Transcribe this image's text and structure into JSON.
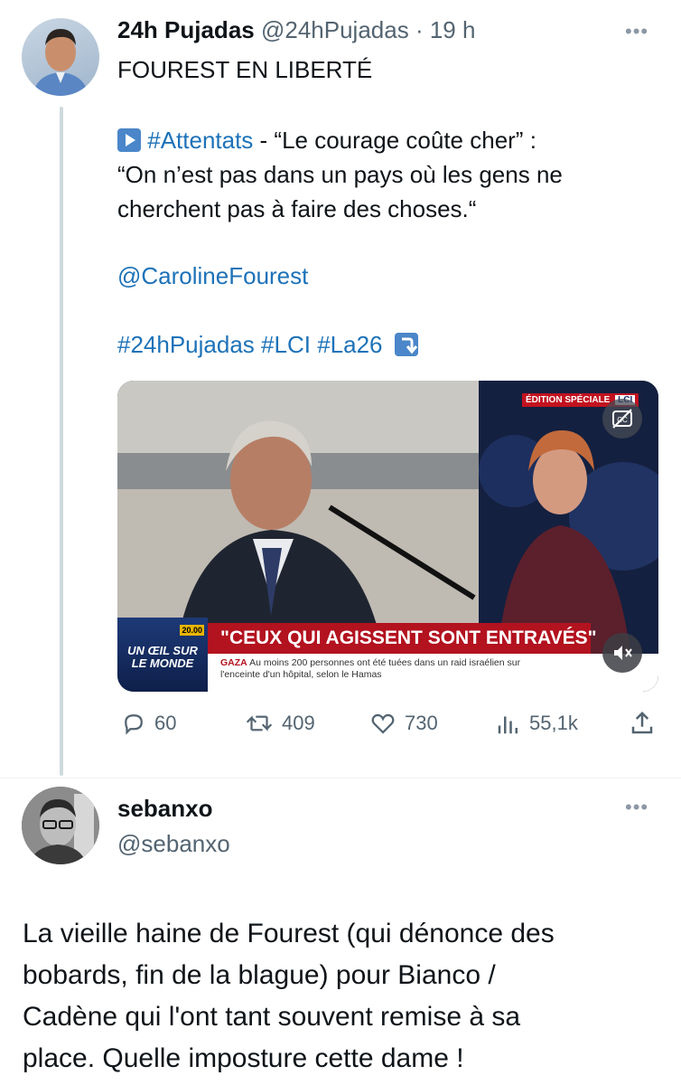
{
  "tweet1": {
    "author_name": "24h Pujadas",
    "author_handle": "@24hPujadas",
    "time": "· 19 h",
    "headline": "FOUREST EN LIBERTÉ",
    "body_hashtag": "#Attentats",
    "body_line1_rest": " - “Le courage coûte cher” :",
    "body_line2": "“On n’est pas dans un pays où les gens ne",
    "body_line3": "cherchent pas à faire des choses.“",
    "mention": "@CarolineFourest",
    "hashtags": [
      "#24hPujadas",
      "#LCI",
      "#La26"
    ],
    "video": {
      "edition_label": "ÉDITION SPÉCIALE",
      "channel": "LCI",
      "show_name": "UN ŒIL SUR LE MONDE",
      "show_time": "20.00",
      "banner_title": "\"CEUX QUI AGISSENT SONT ENTRAVÉS\"",
      "ticker_label": "GAZA",
      "ticker_line1": "Au moins 200 personnes ont été tuées dans un raid israélien sur",
      "ticker_line2": "l'enceinte d'un hôpital, selon le Hamas"
    },
    "stats": {
      "replies": "60",
      "retweets": "409",
      "likes": "730",
      "views": "55,1k"
    }
  },
  "tweet2": {
    "author_name": "sebanxo",
    "author_handle": "@sebanxo",
    "body_lines": [
      "La vieille haine de Fourest (qui dénonce des",
      "bobards, fin de la blague) pour Bianco /",
      "Cadène qui l'ont tant souvent remise à sa",
      "place. Quelle imposture cette dame !"
    ]
  },
  "colors": {
    "link": "#1d72b8",
    "muted": "#536471",
    "banner_red": "#b3121f"
  }
}
